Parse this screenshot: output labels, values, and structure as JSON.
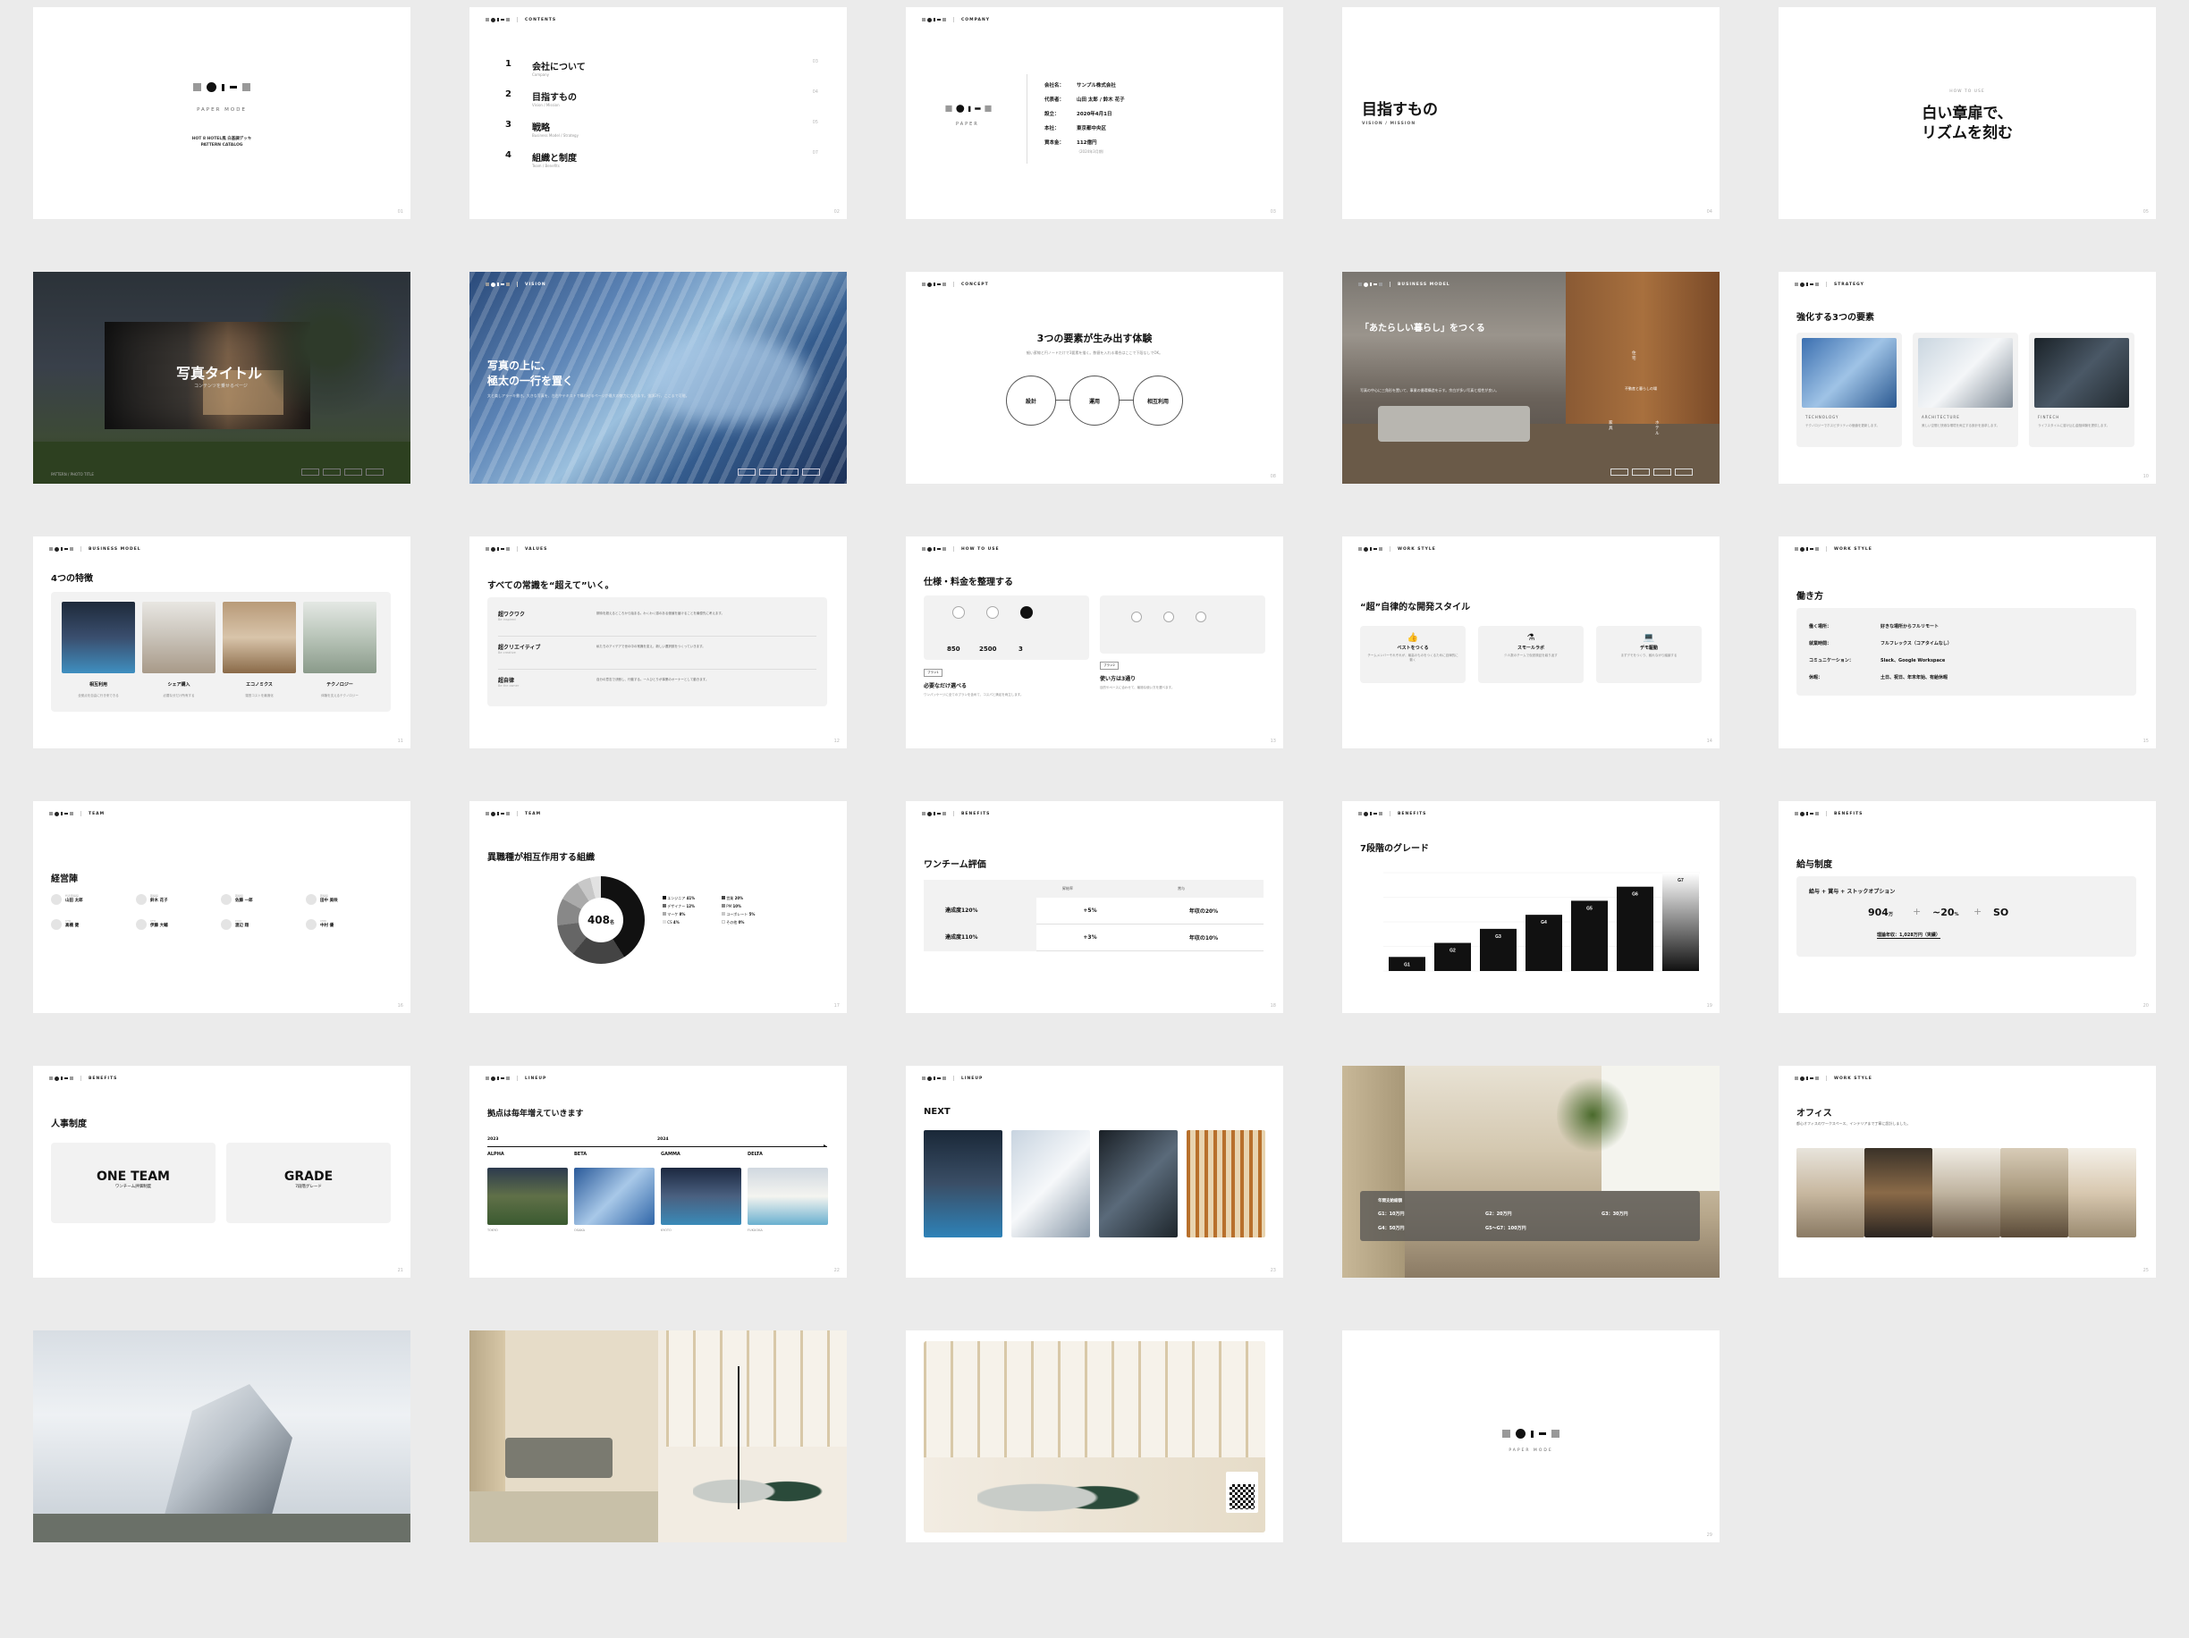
{
  "s1": {
    "logo_text": "PAPER MODE",
    "line1": "HOT 8 HOTEL風 白基調デッキ",
    "line2": "PATTERN CATALOG"
  },
  "s2": {
    "header": "CONTENTS",
    "items": [
      {
        "num": "1",
        "title": "会社について",
        "sub": "Company",
        "pg": "03"
      },
      {
        "num": "2",
        "title": "目指すもの",
        "sub": "Vision / Mission",
        "pg": "04"
      },
      {
        "num": "3",
        "title": "戦略",
        "sub": "Business Model / Strategy",
        "pg": "05"
      },
      {
        "num": "4",
        "title": "組織と制度",
        "sub": "Team / Benefits",
        "pg": "07"
      }
    ]
  },
  "s3": {
    "header": "COMPANY",
    "logo_word": "PAPER",
    "rows": [
      {
        "k": "会社名：",
        "v": "サンプル株式会社"
      },
      {
        "k": "代表者：",
        "v": "山田 太郎 / 鈴木 花子"
      },
      {
        "k": "設立：",
        "v": "2020年4月1日"
      },
      {
        "k": "本社：",
        "v": "東京都中央区"
      },
      {
        "k": "資本金：",
        "v": "112億円"
      }
    ],
    "note": "（2024年3月期）"
  },
  "s4": {
    "title": "目指すもの",
    "sub": "VISION / MISSION"
  },
  "s5": {
    "kicker": "HOW TO USE",
    "title1": "白い章扉で、",
    "title2": "リズムを刻む"
  },
  "s6": {
    "title": "写真タイトル",
    "sub": "コンテンツを乗せるページ",
    "foot": "PATTERN / PHOTO TITLE"
  },
  "s7": {
    "header": "VISION",
    "title1": "写真の上に、",
    "title2": "極太の一行を置く",
    "body": "文と楽しアラーキ書き。大きな写真を、左右やテキストで構わせるページが最大の魅力になります。強調2行、ここまで可能。"
  },
  "s8": {
    "header": "CONCEPT",
    "title": "3つの要素が生み出す体験",
    "body": "細い罫線と円ノードだけで3要素を描く。数値を入れる場合はここで下段なしでOK。",
    "nodes": [
      "設計",
      "運用",
      "相互利用"
    ]
  },
  "s9": {
    "header": "BUSINESS MODEL",
    "title": "「あたらしい暮らし」をつくる",
    "body": "写真の中心に三角形を置いて、事業の循環構造を示す。余白が多い写真と相性が良い。",
    "nodes": [
      "住宅",
      "不動産と暮らしの場",
      "家具",
      "ホテル"
    ]
  },
  "s10": {
    "header": "STRATEGY",
    "title": "強化する3つの要素",
    "cards": [
      {
        "label": "TECHNOLOGY",
        "body": "テクノロジーでホスピタリティの価値を更新します。"
      },
      {
        "label": "ARCHITECTURE",
        "body": "美しい空間と快適な環境を両立する設計を追求します。"
      },
      {
        "label": "FINTECH",
        "body": "ライフスタイルに溶け込む金融体験を提供します。"
      }
    ]
  },
  "s11": {
    "header": "BUSINESS MODEL",
    "title": "4つの特徴",
    "items": [
      {
        "label": "相互利用",
        "body": "全拠点を自由に行き来できる"
      },
      {
        "label": "シェア購入",
        "body": "必要な分だけ所有する"
      },
      {
        "label": "エコノミクス",
        "body": "運営コストを最適化"
      },
      {
        "label": "テクノロジー",
        "body": "体験を支えるテクノロジー"
      }
    ]
  },
  "s12": {
    "header": "VALUES",
    "title": "すべての常識を“超えて”いく。",
    "rows": [
      {
        "h": "超ワクワク",
        "s": "Be inspired",
        "b": "期待を超えるところから始まる。わくわく感のある価値を届けることを最優先に考えます。"
      },
      {
        "h": "超クリエイティブ",
        "s": "Be creative",
        "b": "私たちのアイデアで世の中の常識を変え、新しい選択肢をつくっていきます。"
      },
      {
        "h": "超自律",
        "s": "Be the owner",
        "b": "自分の意志で決断し、行動する。一人ひとりが事業のオーナーとして動きます。"
      }
    ]
  },
  "s13": {
    "header": "HOW TO USE",
    "title": "仕様・料金を整理する",
    "left": {
      "vals": [
        "850",
        "2500",
        "3"
      ],
      "tag": "プラン1",
      "h": "必要なだけ選べる",
      "b": "ワンパッケージに全てのプランを含めて、コスパと満足を両立します。"
    },
    "right": {
      "tag": "プラン2",
      "h": "使い方は3通り",
      "b": "目的やペースに合わせて、最適な使い方を選べます。"
    }
  },
  "s14": {
    "header": "WORK STYLE",
    "title": "“超”自律的な開発スタイル",
    "cards": [
      {
        "h": "ベストをつくる",
        "b": "チームメンバーそれぞれが、最高のものをつくるために自律的に動く"
      },
      {
        "h": "スモールラボ",
        "b": "少人数のチームで仮説検証を繰り返す"
      },
      {
        "h": "デモ駆動",
        "b": "まずデモをつくり、触れながら議論する"
      }
    ]
  },
  "s15": {
    "header": "WORK STYLE",
    "title": "働き方",
    "rows": [
      {
        "k": "働く場所：",
        "v": "好きな場所からフルリモート"
      },
      {
        "k": "就業時間：",
        "v": "フルフレックス（コアタイムなし）"
      },
      {
        "k": "コミュニケーション：",
        "v": "Slack、Google Workspace"
      },
      {
        "k": "休暇：",
        "v": "土日、祝日、年末年始、有給休暇"
      }
    ]
  },
  "s16": {
    "header": "TEAM",
    "title": "経営陣",
    "people": [
      {
        "r": "代表取締役",
        "n": "山田 太郎"
      },
      {
        "r": "取締役",
        "n": "鈴木 花子"
      },
      {
        "r": "取締役",
        "n": "佐藤 一郎"
      },
      {
        "r": "取締役",
        "n": "田中 美咲"
      },
      {
        "r": "CTO",
        "n": "高橋 健"
      },
      {
        "r": "CFO",
        "n": "伊藤 大輔"
      },
      {
        "r": "COO",
        "n": "渡辺 翔"
      },
      {
        "r": "CMO",
        "n": "中村 優"
      }
    ]
  },
  "s17": {
    "header": "TEAM",
    "title": "異職種が相互作用する組織",
    "center_value": "408",
    "center_unit": "名",
    "legend": [
      {
        "l": "エンジニア",
        "v": "41%"
      },
      {
        "l": "営業",
        "v": "20%"
      },
      {
        "l": "デザイナー",
        "v": "12%"
      },
      {
        "l": "PM",
        "v": "10%"
      },
      {
        "l": "マーケ",
        "v": "8%"
      },
      {
        "l": "コーポレート",
        "v": "5%"
      },
      {
        "l": "CS",
        "v": "4%"
      },
      {
        "l": "その他",
        "v": "0%"
      }
    ]
  },
  "s18": {
    "header": "BENEFITS",
    "title": "ワンチーム評価",
    "cols": [
      "",
      "昇給率",
      "賞与"
    ],
    "rows": [
      {
        "a": "達成度120%",
        "b": "+5%",
        "c": "年収の20%"
      },
      {
        "a": "達成度110%",
        "b": "+3%",
        "c": "年収の10%"
      }
    ]
  },
  "s19": {
    "header": "BENEFITS",
    "title": "7段階のグレード",
    "chart_data": {
      "type": "bar",
      "categories": [
        "G1",
        "G2",
        "G3",
        "G4",
        "G5",
        "G6",
        "G7"
      ],
      "values": [
        1,
        2,
        3,
        4,
        5,
        6,
        7
      ]
    }
  },
  "s20": {
    "header": "BENEFITS",
    "title": "給与制度",
    "line": "給与 + 賞与 + ストックオプション",
    "vals": [
      {
        "v": "904",
        "u": "万"
      },
      {
        "v": "~20",
        "u": "%"
      },
      {
        "v": "SO",
        "u": ""
      }
    ],
    "total": "理論年収：1,028万円（実績）"
  },
  "s21": {
    "header": "BENEFITS",
    "title": "人事制度",
    "boxes": [
      {
        "h": "ONE TEAM",
        "s": "ワンチーム評価制度"
      },
      {
        "h": "GRADE",
        "s": "7段階グレード"
      }
    ]
  },
  "s22": {
    "header": "LINEUP",
    "title": "拠点は毎年増えていきます",
    "years": [
      "2023",
      "2024"
    ],
    "items": [
      {
        "n": "ALPHA",
        "l": "TOKYO"
      },
      {
        "n": "BETA",
        "l": "OSAKA"
      },
      {
        "n": "GAMMA",
        "l": "KYOTO"
      },
      {
        "n": "DELTA",
        "l": "FUKUOKA"
      }
    ]
  },
  "s23": {
    "header": "LINEUP",
    "title": "NEXT"
  },
  "s24": {
    "overlay_title": "年間支給総額",
    "cells": [
      "G1：10万円",
      "G2：20万円",
      "G3：30万円",
      "G4：50万円",
      "G5〜G7：100万円"
    ]
  },
  "s25": {
    "header": "WORK STYLE",
    "title": "オフィス",
    "body": "都心オフィスのワークスペース、インテリアまで丁寧に設計しました。"
  },
  "s29": {
    "logo_text": "PAPER MODE"
  },
  "colors": {
    "accent": "#111111",
    "card": "#f2f2f2",
    "bg": "#ebebeb"
  }
}
